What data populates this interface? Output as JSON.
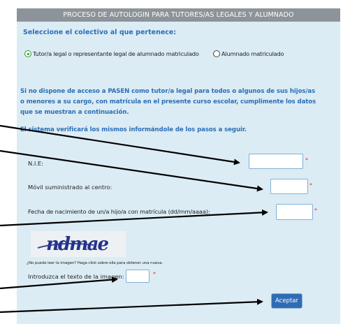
{
  "header": {
    "title": "PROCESO DE AUTOLOGIN PARA TUTORES/AS LEGALES Y ALUMNADO"
  },
  "collective": {
    "prompt": "Seleccione el colectivo al que pertenece:",
    "option_tutor": "Tutor/a legal o representante legal de alumnado matriculado",
    "option_student": "Alumnado matriculado",
    "selected": "tutor"
  },
  "info": {
    "line1": "Si no dispone de acceso a PASEN como tutor/a legal para todos o algunos de sus hijos/as",
    "line2": "o menores a su cargo, con matrícula en el presente curso escolar, cumplimente los datos",
    "line3": "que se muestran a continuación.",
    "line4": "El sistema verificará los mismos informándole de los pasos a seguir."
  },
  "form": {
    "nie_label": "N.I.E:",
    "phone_label": "Móvil suministrado al centro:",
    "birthdate_label": "Fecha de nacimiento de un/a hijo/a con matrícula (dd/mm/aaaa):",
    "nie_value": "",
    "phone_value": "",
    "birthdate_value": "",
    "required_mark": "*"
  },
  "captcha": {
    "image_text": "ndmae",
    "help": "¿No puede leer la imagen? Haga click sobre ella para obtener una nueva.",
    "label": "Introduzca el texto de la imagen:",
    "value": ""
  },
  "submit_label": "Aceptar",
  "colors": {
    "header_bg": "#8c949a",
    "panel_bg": "#dcecf4",
    "accent_blue": "#2a6fb8",
    "button_bg": "#2f6cb4",
    "required": "#e03030"
  }
}
